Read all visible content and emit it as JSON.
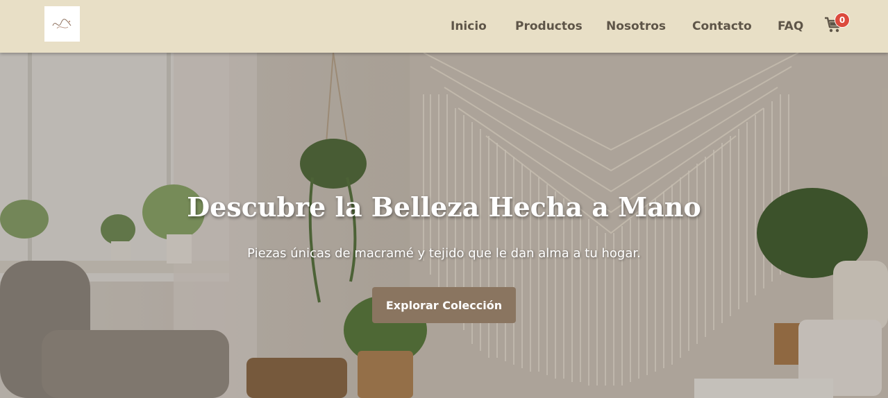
{
  "navbar": {
    "logo_alt": "logo",
    "links": [
      {
        "label": "Inicio"
      },
      {
        "label": "Productos"
      },
      {
        "label": "Nosotros"
      },
      {
        "label": "Contacto"
      },
      {
        "label": "FAQ"
      }
    ],
    "cart": {
      "icon": "cart-icon",
      "count": "0"
    }
  },
  "hero": {
    "title": "Descubre la Belleza Hecha a Mano",
    "subtitle": "Piezas únicas de macramé y tejido que le dan alma a tu hogar.",
    "button_label": "Explorar Colección"
  },
  "colors": {
    "navbar_bg": "#e8dfc6",
    "nav_text": "#5e5548",
    "button_bg": "#8a7560",
    "badge_bg": "#dc4a3d"
  }
}
